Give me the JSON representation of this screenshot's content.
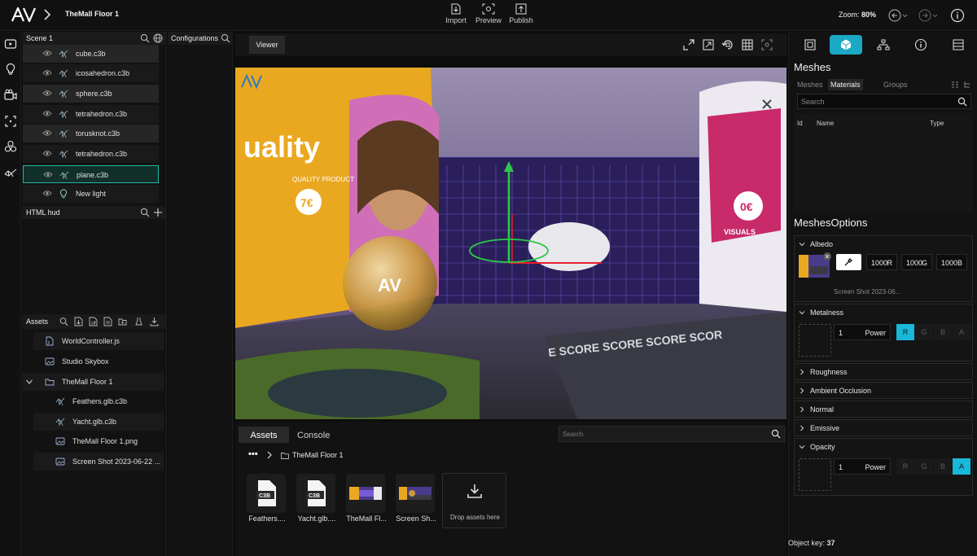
{
  "topbar": {
    "project_title": "TheMall Floor 1",
    "actions": [
      {
        "label": "Import",
        "icon": "import-icon"
      },
      {
        "label": "Preview",
        "icon": "preview-icon"
      },
      {
        "label": "Publish",
        "icon": "publish-icon"
      }
    ],
    "zoom_label": "Zoom:",
    "zoom_value": "80%"
  },
  "rail": {
    "icons": [
      "video-icon",
      "lightbulb-icon",
      "camera-icon",
      "selection-icon",
      "objects-icon",
      "mesh-icon"
    ]
  },
  "scene": {
    "title": "Scene 1",
    "items": [
      {
        "name": "cube.c3b",
        "type": "mesh"
      },
      {
        "name": "icosahedron.c3b",
        "type": "mesh"
      },
      {
        "name": "sphere.c3b",
        "type": "mesh"
      },
      {
        "name": "tetrahedron.c3b",
        "type": "mesh"
      },
      {
        "name": "torusknot.c3b",
        "type": "mesh"
      },
      {
        "name": "tetrahedron.c3b",
        "type": "mesh"
      },
      {
        "name": "plane.c3b",
        "type": "mesh",
        "selected": true
      },
      {
        "name": "New light",
        "type": "light"
      }
    ],
    "hud_title": "HTML hud"
  },
  "assets_tree": {
    "title": "Assets",
    "items": [
      {
        "name": "WorldController.js",
        "icon": "js-file-icon"
      },
      {
        "name": "Studio Skybox",
        "icon": "image-icon"
      },
      {
        "name": "TheMall Floor 1",
        "icon": "folder-icon"
      },
      {
        "name": "Feathers.glb.c3b",
        "icon": "mesh-icon"
      },
      {
        "name": "Yacht.glb.c3b",
        "icon": "mesh-icon"
      },
      {
        "name": "TheMall Floor 1.png",
        "icon": "image-icon"
      },
      {
        "name": "Screen Shot 2023-06-22 ...",
        "icon": "image-icon"
      }
    ]
  },
  "config": {
    "title": "Configurations"
  },
  "viewer": {
    "tab": "Viewer"
  },
  "bottom": {
    "tabs": [
      "Assets",
      "Console"
    ],
    "search_placeholder": "Search",
    "breadcrumb_dots": "•••",
    "breadcrumb_folder": "TheMall Floor 1",
    "cards": [
      {
        "caption": "Feathers....",
        "badge": "C3B"
      },
      {
        "caption": "Yacht.glb....",
        "badge": "C3B"
      },
      {
        "caption": "TheMall Fl...",
        "badge": ""
      },
      {
        "caption": "Screen Sh...",
        "badge": ""
      }
    ],
    "drop_label": "Drop assets here"
  },
  "viewport_scene": {
    "left_banner": "uality",
    "left_banner_sub": "QUALITY PRODUCT",
    "price_left": "7€",
    "price_right": "0€",
    "right_banner": "VISUALS",
    "floor_text": "E SCORE SCORE SCORE SCOR",
    "logo_text": "AV"
  },
  "right": {
    "meshes_title": "Meshes",
    "subtabs": [
      "Meshes",
      "Materials",
      "Groups"
    ],
    "search_placeholder": "Search",
    "columns": [
      "Id",
      "Name",
      "Type"
    ],
    "options_title": "MeshesOptions",
    "albedo": {
      "label": "Albedo",
      "r": "1000",
      "g": "1000",
      "b": "1000",
      "r_tag": "R",
      "g_tag": "G",
      "b_tag": "B",
      "texture_name": "Screen Shot 2023-06..."
    },
    "metalness": {
      "label": "Metalness",
      "value": "1",
      "mode": "Power",
      "channels": [
        "R",
        "G",
        "B",
        "A"
      ],
      "active": "R"
    },
    "collapsed": [
      "Roughness",
      "Ambient Occlusion",
      "Normal",
      "Emissive"
    ],
    "opacity": {
      "label": "Opacity",
      "value": "1",
      "mode": "Power",
      "channels": [
        "R",
        "G",
        "B",
        "A"
      ],
      "active": "A"
    },
    "object_key_label": "Object key:",
    "object_key_value": "37"
  },
  "colors": {
    "accent": "#1ab8d8",
    "selected_border": "#22b8a4"
  }
}
